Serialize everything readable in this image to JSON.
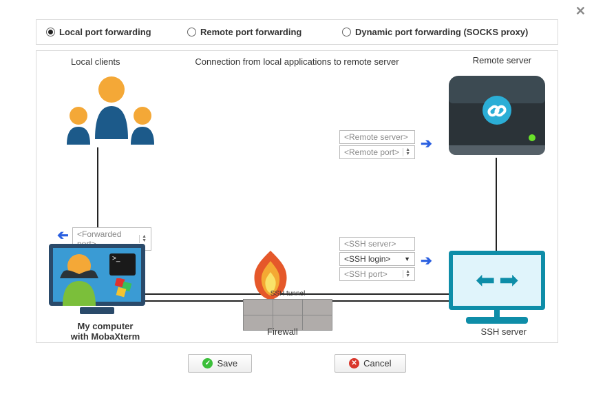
{
  "radios": {
    "local": "Local port forwarding",
    "remote": "Remote port forwarding",
    "dynamic": "Dynamic port forwarding (SOCKS proxy)",
    "selected": "local"
  },
  "subtitle": "Connection from local applications to remote server",
  "labels": {
    "local_clients": "Local clients",
    "remote_server": "Remote server",
    "my_computer_l1": "My computer",
    "my_computer_l2": "with MobaXterm",
    "firewall": "Firewall",
    "ssh_server": "SSH server",
    "ssh_tunnel": "SSH tunnel"
  },
  "fields": {
    "forwarded_port": "<Forwarded port>",
    "remote_server": "<Remote server>",
    "remote_port": "<Remote port>",
    "ssh_server": "<SSH server>",
    "ssh_login": "<SSH login>",
    "ssh_port": "<SSH port>"
  },
  "buttons": {
    "save": "Save",
    "cancel": "Cancel"
  }
}
